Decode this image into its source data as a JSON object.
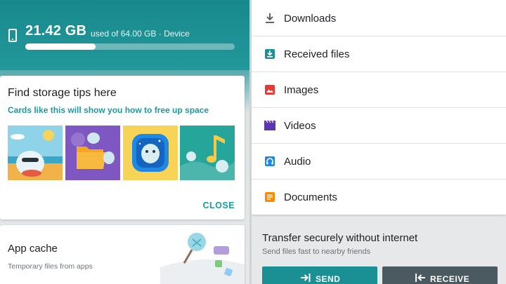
{
  "storage": {
    "used": "21.42 GB",
    "total_text": "used of 64.00 GB · Device",
    "used_fraction": 0.3347,
    "icon": "phone-icon"
  },
  "tips_card": {
    "title": "Find storage tips here",
    "subtitle": "Cards like this will show you how to free up space",
    "close_label": "CLOSE"
  },
  "cache_card": {
    "title": "App cache",
    "subtitle": "Temporary files from apps"
  },
  "categories": [
    {
      "label": "Downloads",
      "icon": "download-icon",
      "color": "#5f6368"
    },
    {
      "label": "Received files",
      "icon": "received-files-icon",
      "color": "#1a8f94"
    },
    {
      "label": "Images",
      "icon": "image-icon",
      "color": "#e53935"
    },
    {
      "label": "Videos",
      "icon": "video-icon",
      "color": "#5e35b1"
    },
    {
      "label": "Audio",
      "icon": "audio-icon",
      "color": "#1e88e5"
    },
    {
      "label": "Documents",
      "icon": "document-icon",
      "color": "#fb8c00"
    }
  ],
  "transfer": {
    "title": "Transfer securely without internet",
    "subtitle": "Send files fast to nearby friends",
    "send_label": "SEND",
    "receive_label": "RECEIVE"
  },
  "colors": {
    "accent": "#1a9aa0",
    "header": "#1e8f93",
    "send_button": "#1a8f94",
    "receive_button": "#4b5a61"
  }
}
